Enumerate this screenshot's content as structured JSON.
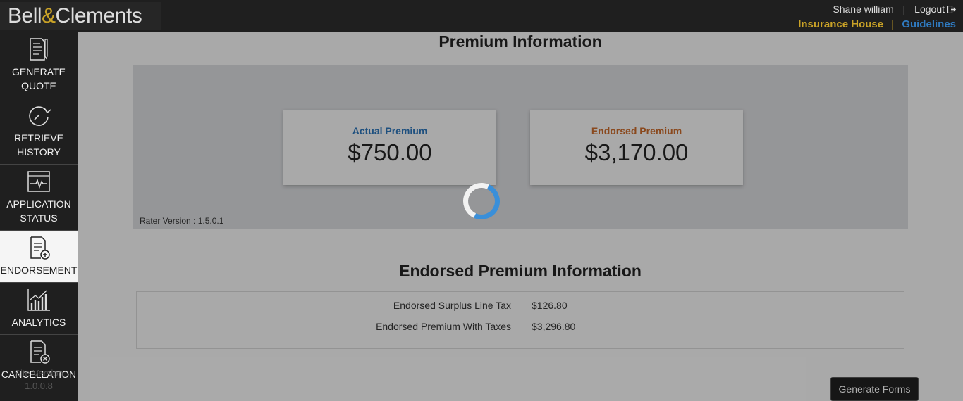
{
  "brand": {
    "name_part1": "Bell",
    "amp": "&",
    "name_part2": "Clements"
  },
  "header": {
    "user_name": "Shane william",
    "separator": "|",
    "logout_label": "Logout",
    "company": "Insurance House",
    "guidelines_label": "Guidelines"
  },
  "sidebar": {
    "items": [
      {
        "line1": "GENERATE",
        "line2": "QUOTE",
        "icon": "quote-document-icon"
      },
      {
        "line1": "RETRIEVE",
        "line2": "HISTORY",
        "icon": "history-icon"
      },
      {
        "line1": "APPLICATION",
        "line2": "STATUS",
        "icon": "status-pulse-icon"
      },
      {
        "line1": "ENDORSEMENT",
        "line2": "",
        "icon": "endorsement-add-icon"
      },
      {
        "line1": "ANALYTICS",
        "line2": "",
        "icon": "analytics-chart-icon"
      },
      {
        "line1": "CANCELLATION",
        "line2": "",
        "icon": "cancellation-document-icon"
      }
    ],
    "version_label": "Site Version",
    "version": "1.0.0.8"
  },
  "premium": {
    "title": "Premium Information",
    "actual_label": "Actual Premium",
    "actual_value": "$750.00",
    "endorsed_label": "Endorsed Premium",
    "endorsed_value": "$3,170.00",
    "rater_version": "Rater Version : 1.5.0.1"
  },
  "endorsed_info": {
    "title": "Endorsed Premium Information",
    "rows": [
      {
        "label": "Endorsed Surplus Line Tax",
        "value": "$126.80"
      },
      {
        "label": "Endorsed Premium With Taxes",
        "value": "$3,296.80"
      }
    ]
  },
  "actions": {
    "generate_forms": "Generate Forms"
  },
  "colors": {
    "brand_gold": "#c9a227",
    "link_blue": "#2f7ac0",
    "actual_blue": "#2a6fb0",
    "endorsed_orange": "#c0662a"
  }
}
